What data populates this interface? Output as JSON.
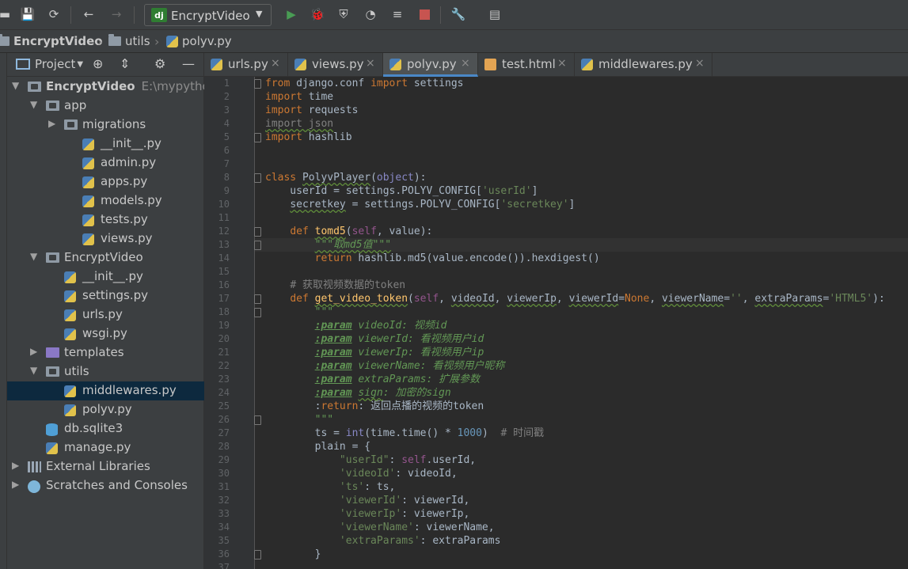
{
  "toolbar": {
    "run_config_label": "EncryptVideo",
    "run_config_badge": "dj",
    "icons": [
      "open-icon",
      "save-icon",
      "sync-icon",
      "back-icon",
      "forward-icon",
      "run-icon",
      "debug-icon",
      "coverage-icon",
      "profile-icon",
      "concurrency-icon",
      "stop-icon",
      "settings-icon",
      "structure-icon"
    ],
    "colors": {
      "run": "#499c54",
      "debug": "#499c54",
      "stop": "#c75450"
    }
  },
  "breadcrumb": {
    "items": [
      "EncryptVideo",
      "utils",
      "polyv.py"
    ]
  },
  "project_panel": {
    "title": "Project",
    "tree": [
      {
        "label": "EncryptVideo",
        "hint": "E:\\mypython",
        "icon": "folder",
        "expanded": true,
        "bold": true
      },
      {
        "label": "app",
        "icon": "folder",
        "expanded": true
      },
      {
        "label": "migrations",
        "icon": "folder",
        "expanded": false
      },
      {
        "label": "__init__.py",
        "icon": "python-file"
      },
      {
        "label": "admin.py",
        "icon": "python-file"
      },
      {
        "label": "apps.py",
        "icon": "python-file"
      },
      {
        "label": "models.py",
        "icon": "python-file"
      },
      {
        "label": "tests.py",
        "icon": "python-file"
      },
      {
        "label": "views.py",
        "icon": "python-file"
      },
      {
        "label": "EncryptVideo",
        "icon": "folder",
        "expanded": true
      },
      {
        "label": "__init__.py",
        "icon": "python-file"
      },
      {
        "label": "settings.py",
        "icon": "python-file"
      },
      {
        "label": "urls.py",
        "icon": "python-file"
      },
      {
        "label": "wsgi.py",
        "icon": "python-file"
      },
      {
        "label": "templates",
        "icon": "folder-templates",
        "expanded": false
      },
      {
        "label": "utils",
        "icon": "folder",
        "expanded": true
      },
      {
        "label": "middlewares.py",
        "icon": "python-file",
        "selected": true
      },
      {
        "label": "polyv.py",
        "icon": "python-file"
      },
      {
        "label": "db.sqlite3",
        "icon": "database"
      },
      {
        "label": "manage.py",
        "icon": "python-file"
      },
      {
        "label": "External Libraries",
        "icon": "libraries",
        "expanded": false
      },
      {
        "label": "Scratches and Consoles",
        "icon": "scratches",
        "expanded": false
      }
    ]
  },
  "tabs": [
    {
      "label": "urls.py",
      "icon": "python-file",
      "active": false
    },
    {
      "label": "views.py",
      "icon": "python-file",
      "active": false
    },
    {
      "label": "polyv.py",
      "icon": "python-file",
      "active": true
    },
    {
      "label": "test.html",
      "icon": "html-file",
      "active": false
    },
    {
      "label": "middlewares.py",
      "icon": "python-file",
      "active": false
    }
  ],
  "close_glyph": "×",
  "editor": {
    "current_line": 13,
    "line_numbers": [
      "1",
      "2",
      "3",
      "4",
      "5",
      "6",
      "7",
      "8",
      "9",
      "10",
      "11",
      "12",
      "13",
      "14",
      "15",
      "16",
      "17",
      "18",
      "19",
      "20",
      "21",
      "22",
      "23",
      "24",
      "25",
      "26",
      "27",
      "28",
      "29",
      "30",
      "31",
      "32",
      "33",
      "34",
      "35",
      "36",
      "37"
    ],
    "lines": [
      "from django.conf import settings",
      "import time",
      "import requests",
      "import json",
      "import hashlib",
      "",
      "",
      "class PolyvPlayer(object):",
      "    userId = settings.POLYV_CONFIG['userId']",
      "    secretkey = settings.POLYV_CONFIG['secretkey']",
      "",
      "    def tomd5(self, value):",
      "        \"\"\"取md5值\"\"\"",
      "        return hashlib.md5(value.encode()).hexdigest()",
      "",
      "    # 获取视频数据的token",
      "    def get_video_token(self, videoId, viewerIp, viewerId=None, viewerName='', extraParams='HTML5'):",
      "        \"\"\"",
      "        :param videoId: 视频id",
      "        :param viewerId: 看视频用户id",
      "        :param viewerIp: 看视频用户ip",
      "        :param viewerName: 看视频用户昵称",
      "        :param extraParams: 扩展参数",
      "        :param sign: 加密的sign",
      "        :return: 返回点播的视频的token",
      "        \"\"\"",
      "        ts = int(time.time() * 1000)  # 时间戳",
      "        plain = {",
      "            \"userId\": self.userId,",
      "            'videoId': videoId,",
      "            'ts': ts,",
      "            'viewerId': viewerId,",
      "            'viewerIp': viewerIp,",
      "            'viewerName': viewerName,",
      "            'extraParams': extraParams",
      "        }",
      ""
    ]
  }
}
